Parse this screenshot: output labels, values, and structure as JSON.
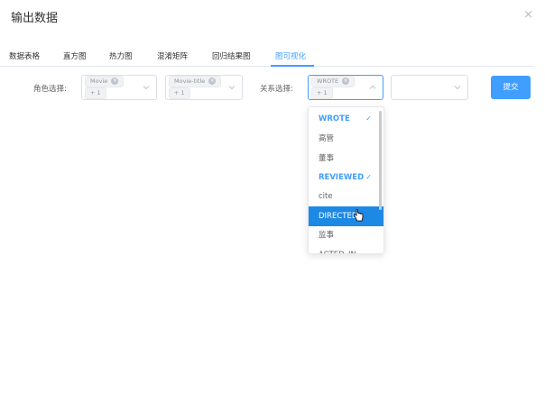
{
  "dialog": {
    "title": "输出数据",
    "close_icon": "close-icon"
  },
  "tabs": [
    "数据表格",
    "直方图",
    "热力图",
    "混淆矩阵",
    "回归结果图",
    "图可视化"
  ],
  "active_tab_index": 5,
  "form": {
    "role_label": "角色选择:",
    "role_select_1": {
      "tag": "Movie",
      "more": "+ 1"
    },
    "role_select_2": {
      "tag": "Movie-title",
      "more": "+ 1"
    },
    "relation_label": "关系选择:",
    "relation_select": {
      "tag": "WROTE",
      "more": "+ 1"
    },
    "extra_select": {
      "value": ""
    },
    "submit_label": "提交"
  },
  "dropdown": {
    "options": [
      {
        "label": "WROTE",
        "selected": true
      },
      {
        "label": "高管",
        "selected": false
      },
      {
        "label": "董事",
        "selected": false
      },
      {
        "label": "REVIEWED",
        "selected": true
      },
      {
        "label": "cite",
        "selected": false
      },
      {
        "label": "DIRECTED",
        "selected": false,
        "hovered": true
      },
      {
        "label": "监事",
        "selected": false
      },
      {
        "label": "ACTED_IN",
        "selected": false
      }
    ]
  },
  "colors": {
    "accent": "#409eff",
    "hover": "#1e88e5",
    "border": "#dcdfe6"
  }
}
